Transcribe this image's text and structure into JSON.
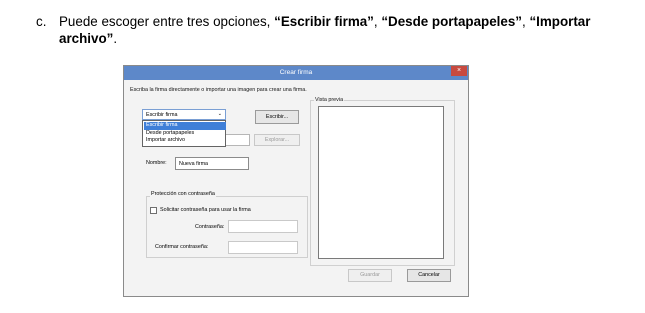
{
  "document": {
    "marker": "c.",
    "text_before": "Puede escoger entre tres opciones, ",
    "option1": "“Escribir firma”",
    "sep1": ", ",
    "option2": "“Desde portapapeles”",
    "sep2": ", ",
    "option3": "“Importar archivo”",
    "text_after": "."
  },
  "dialog": {
    "title": "Crear firma",
    "close_glyph": "×",
    "instruction": "Escriba la firma directamente o importar una imagen para crear una firma.",
    "preview_label": "Vista previa",
    "source_select": {
      "value": "Escribir firma",
      "arrow": "⌄",
      "options": [
        "Escribir firma",
        "Desde portapapeles",
        "Importar archivo"
      ]
    },
    "buttons": {
      "write": "Escribir...",
      "browse": "Explorar...",
      "save": "Guardar",
      "cancel": "Cancelar"
    },
    "name_label": "Nombre:",
    "name_value": "Nueva firma",
    "protection": {
      "title": "Protección con contraseña",
      "checkbox_label": "Solicitar contraseña para usar la firma",
      "password_label": "Contraseña:",
      "confirm_label": "Confirmar contraseña:"
    }
  },
  "colors": {
    "titlebar": "#5d88c9",
    "close": "#c84a3f",
    "selected_option": "#3f7fd8"
  }
}
